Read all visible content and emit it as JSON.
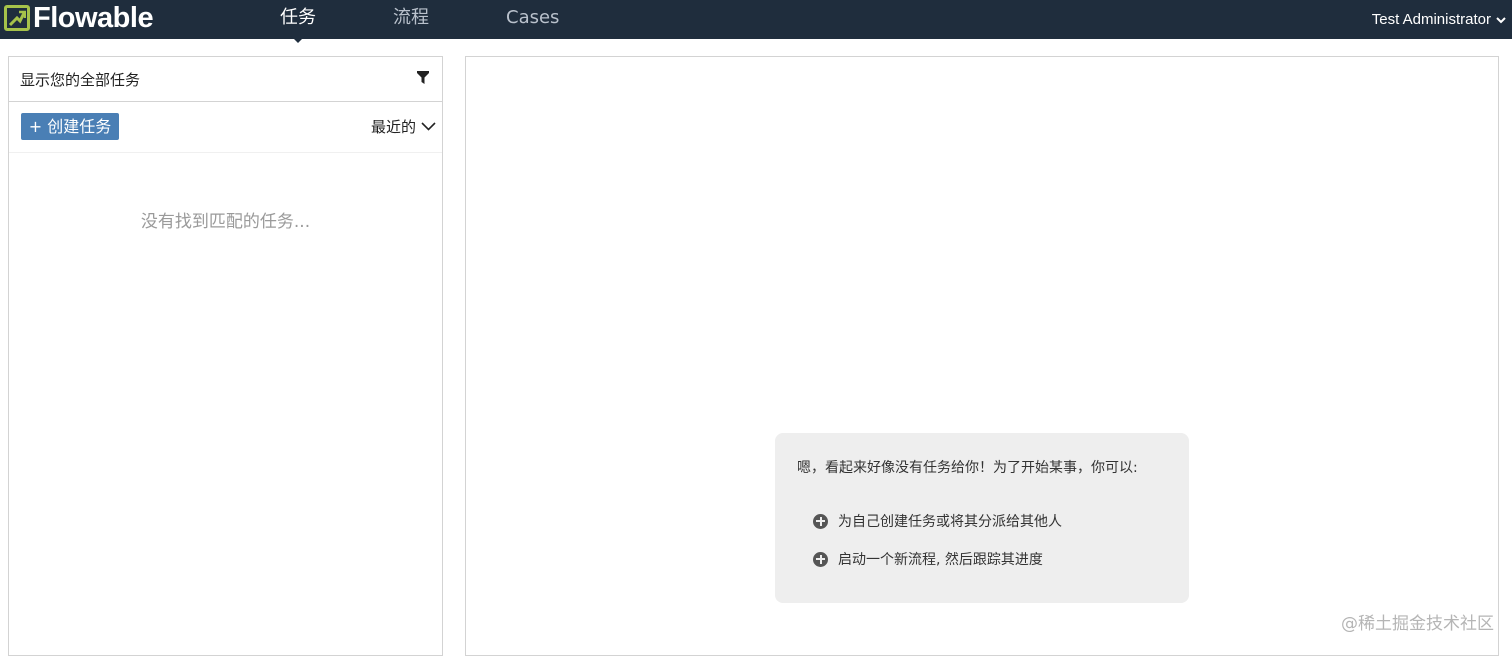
{
  "navbar": {
    "logo_text": "Flowable",
    "tabs": [
      {
        "label": "任务",
        "active": true
      },
      {
        "label": "流程",
        "active": false
      },
      {
        "label": "Cases",
        "active": false
      }
    ],
    "user": "Test Administrator",
    "user_icon": "chevron-down-icon"
  },
  "task_list": {
    "filter_text": "显示您的全部任务",
    "filter_icon": "filter-icon",
    "create_button": "+ 创建任务",
    "sort_label": "最近的",
    "empty_message": "没有找到匹配的任务..."
  },
  "help": {
    "title": "嗯，看起来好像没有任务给你！为了开始某事，你可以:",
    "items": [
      {
        "icon": "plus-circle-icon",
        "text": "为自己创建任务或将其分派给其他人"
      },
      {
        "icon": "plus-circle-icon",
        "text": "启动一个新流程, 然后跟踪其进度"
      }
    ]
  },
  "watermark": "@稀土掘金技术社区",
  "colors": {
    "navbar_bg": "#1f2d3d",
    "logo_accent": "#a6c24a",
    "button_bg": "#4a7fb5"
  }
}
